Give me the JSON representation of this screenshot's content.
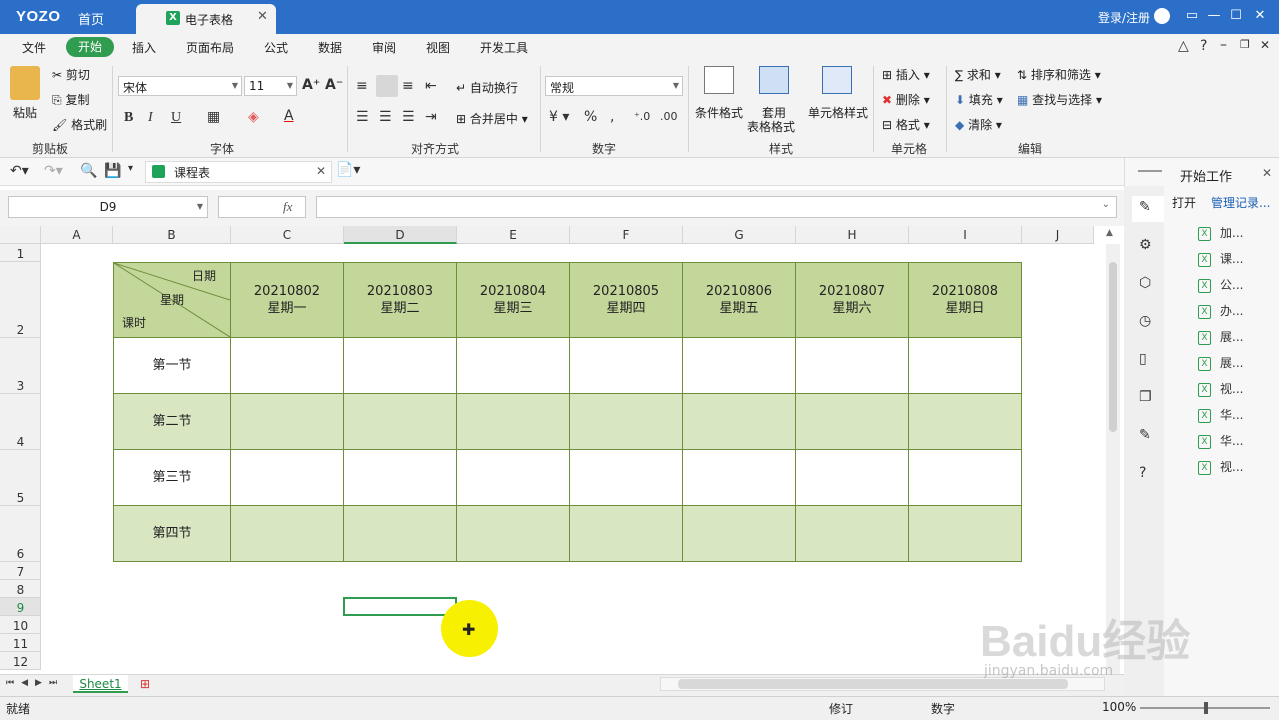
{
  "titlebar": {
    "logo": "YOZO",
    "home_tab": "首页",
    "doc_tab": "电子表格",
    "login": "登录/注册"
  },
  "menu": [
    "文件",
    "开始",
    "插入",
    "页面布局",
    "公式",
    "数据",
    "审阅",
    "视图",
    "开发工具"
  ],
  "ribbon": {
    "paste": "粘贴",
    "cut": "剪切",
    "copy": "复制",
    "format_painter": "格式刷",
    "clipboard_group": "剪贴板",
    "font_name": "宋体",
    "font_size": "11",
    "font_group": "字体",
    "bold": "B",
    "italic": "I",
    "underline": "U",
    "wrap_text": "自动换行",
    "merge_center": "合并居中",
    "align_group": "对齐方式",
    "number_format": "常规",
    "number_group": "数字",
    "cond_format": "条件格式",
    "table_format": "套用",
    "table_format2": "表格格式",
    "cell_style": "单元格样式",
    "style_group": "样式",
    "insert": "插入",
    "delete": "删除",
    "format": "格式",
    "cell_group": "单元格",
    "sum": "求和",
    "fill": "填充",
    "clear": "清除",
    "sort_filter": "排序和筛选",
    "find_select": "查找与选择",
    "edit_group": "编辑"
  },
  "quickbar": {
    "sheet_name": "课程表"
  },
  "formula_bar": {
    "name_box": "D9",
    "fx": "fx",
    "content": ""
  },
  "columns": [
    "A",
    "B",
    "C",
    "D",
    "E",
    "F",
    "G",
    "H",
    "I",
    "J"
  ],
  "rows": [
    "1",
    "2",
    "3",
    "4",
    "5",
    "6",
    "7",
    "8",
    "9",
    "10",
    "11",
    "12"
  ],
  "table": {
    "corner": {
      "date": "日期",
      "week": "星期",
      "period": "课时"
    },
    "days": [
      {
        "date": "20210802",
        "weekday": "星期一"
      },
      {
        "date": "20210803",
        "weekday": "星期二"
      },
      {
        "date": "20210804",
        "weekday": "星期三"
      },
      {
        "date": "20210805",
        "weekday": "星期四"
      },
      {
        "date": "20210806",
        "weekday": "星期五"
      },
      {
        "date": "20210807",
        "weekday": "星期六"
      },
      {
        "date": "20210808",
        "weekday": "星期日"
      }
    ],
    "periods": [
      "第一节",
      "第二节",
      "第三节",
      "第四节"
    ]
  },
  "sheet_tabs": [
    "Sheet1"
  ],
  "status": {
    "ready": "就绪",
    "revise": "修订",
    "numlock": "数字",
    "zoom": "100%"
  },
  "right_panel": {
    "title": "开始工作",
    "open": "打开",
    "manage": "管理记录...",
    "files": [
      "加...",
      "课...",
      "公...",
      "办...",
      "展...",
      "展...",
      "视...",
      "华...",
      "华...",
      "视..."
    ]
  },
  "watermark": {
    "brand": "Baidu经验",
    "url": "jingyan.baidu.com"
  },
  "colors": {
    "title_blue": "#2b6fc9",
    "accent_green": "#2f9c50",
    "header_green": "#c3d79b",
    "band_green": "#d8e6c2"
  }
}
